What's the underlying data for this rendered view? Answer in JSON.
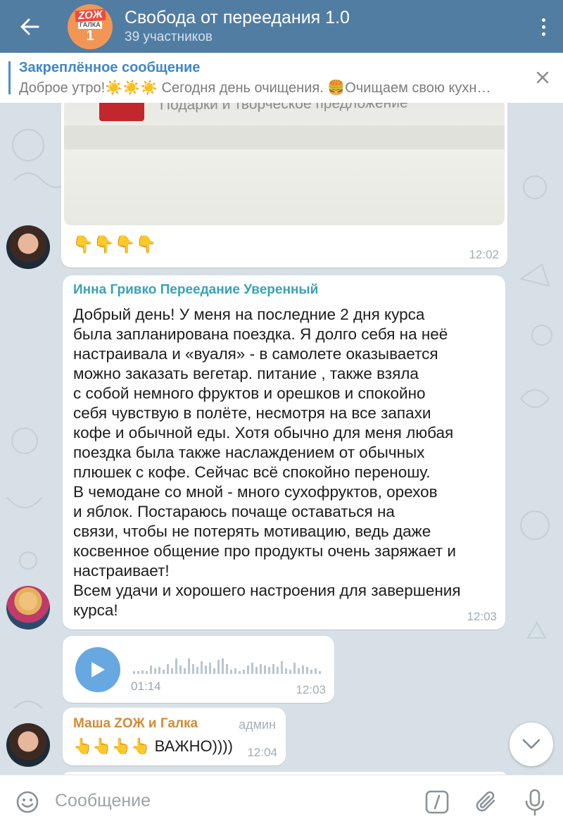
{
  "header": {
    "title": "Свобода от переедания 1.0",
    "subtitle": "39 участников",
    "avatar": {
      "line1": "ZOЖ",
      "line2": "ГАЛКА",
      "line3": "1"
    }
  },
  "pinned": {
    "title": "Закреплённое сообщение",
    "text": "Доброе утро!☀️☀️☀️  Сегодня день очищения. 🍔Очищаем свою кухн…"
  },
  "messages": {
    "image_msg": {
      "caption_in_image": "Подарки и творческое предложение",
      "emojis": "👇👇👇👇",
      "time": "12:02"
    },
    "text_msg": {
      "sender": "Инна Гривко Переедание Уверенный",
      "sender_color": "#3aa1b8",
      "text": "Добрый день! У меня на последние 2 дня курса\nбыла запланирована поездка. Я долго себя на неё\nнастраивала и «вуаля» - в самолете оказывается\nможно заказать вегетар. питание , также взяла\nс собой немного фруктов и орешков и спокойно\nсебя чувствую в полёте, несмотря на все запахи\nкофе и обычной еды. Хотя обычно для меня любая\nпоездка была также наслаждением от обычных\nплюшек с кофе. Сейчас всё спокойно переношу.\nВ чемодане со мной - много сухофруктов, орехов\nи яблок. Постараюсь почаще оставаться на\nсвязи, чтобы не потерять мотивацию, ведь даже\nкосвенное общение про продукты очень заряжает и\nнастраивает!\nВсем удачи и хорошего настроения для завершения\nкурса!",
      "time": "12:03"
    },
    "voice_msg": {
      "duration": "01:14",
      "time": "12:03"
    },
    "admin_msg": {
      "sender": "Маша ZОЖ и Галка",
      "badge": "админ",
      "text": "👆👆👆👆 ВАЖНО))))",
      "time": "12:04"
    }
  },
  "input": {
    "placeholder": "Сообщение"
  },
  "colors": {
    "header": "#527da3",
    "accent": "#3d87cd",
    "admin_name": "#d58a35"
  }
}
